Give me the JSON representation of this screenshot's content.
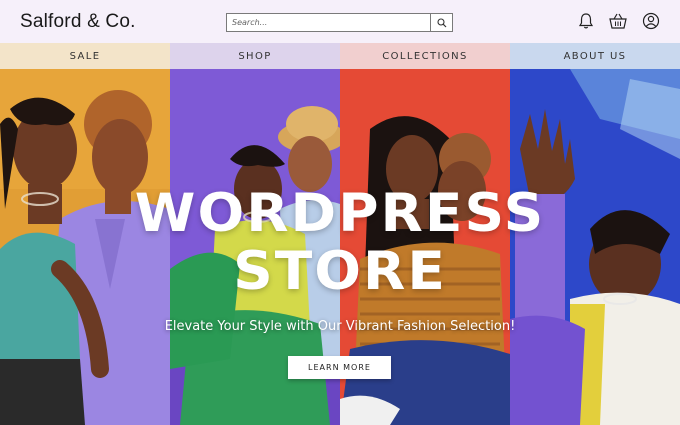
{
  "header": {
    "brand": "Salford & Co.",
    "search_placeholder": "Search...",
    "icons": [
      "search-icon",
      "bell-icon",
      "basket-icon",
      "user-account-icon"
    ]
  },
  "nav": {
    "items": [
      {
        "label": "SALE",
        "color": "#f3e4c9"
      },
      {
        "label": "SHOP",
        "color": "#ddd3ec"
      },
      {
        "label": "COLLECTIONS",
        "color": "#f1cfcf"
      },
      {
        "label": "ABOUT US",
        "color": "#c9d8ee"
      }
    ]
  },
  "hero": {
    "title_line1": "WORDPRESS",
    "title_line2": "STORE",
    "subtitle": "Elevate Your Style with Our Vibrant Fashion Selection!",
    "cta_label": "LEARN MORE",
    "panel_colors": [
      "#e7a53a",
      "#7e5ad6",
      "#e54a35",
      "#2d48c9"
    ]
  }
}
